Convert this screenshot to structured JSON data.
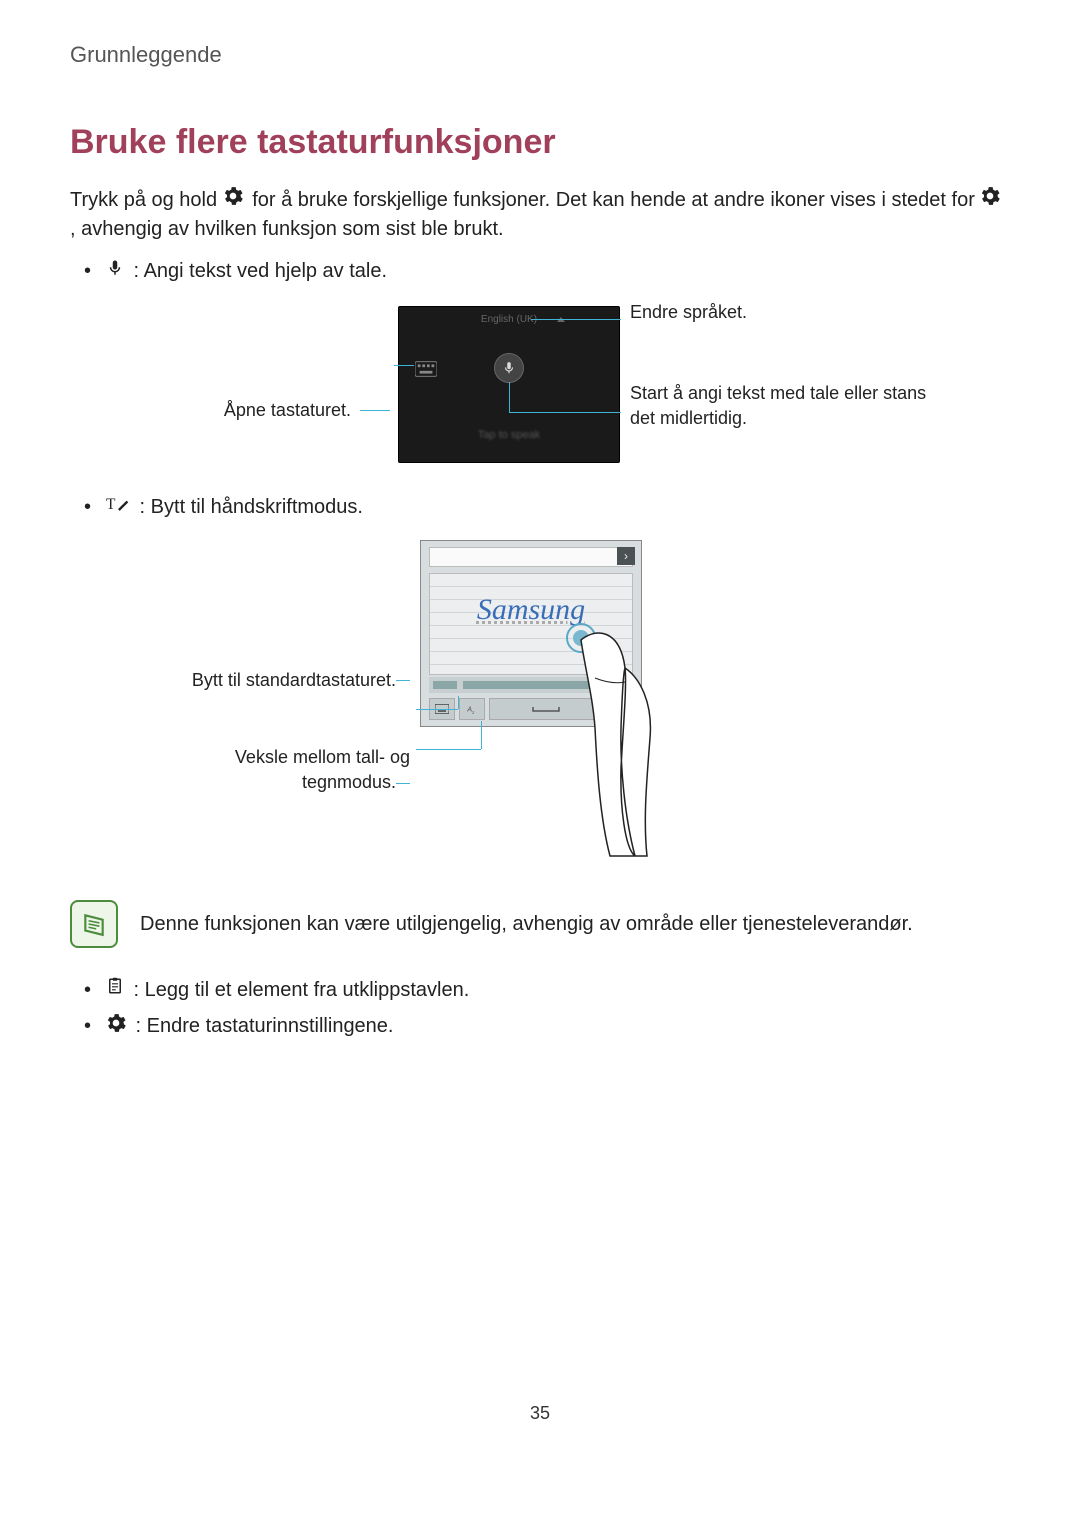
{
  "breadcrumb": "Grunnleggende",
  "title": "Bruke flere tastaturfunksjoner",
  "intro_part1": "Trykk på og hold ",
  "intro_part2": " for å bruke forskjellige funksjoner. Det kan hende at andre ikoner vises i stedet for ",
  "intro_part3": ", avhengig av hvilken funksjon som sist ble brukt.",
  "bullet_voice": " : Angi tekst ved hjelp av tale.",
  "voice_fig": {
    "left_label": "Åpne tastaturet.",
    "right_top": "Endre språket.",
    "right_bottom": "Start å angi tekst med tale eller stans det midlertidig.",
    "lang_text": "English (UK)",
    "tap_text": "Tap to speak"
  },
  "bullet_handwriting": " : Bytt til håndskriftmodus.",
  "hand_fig": {
    "left_top": "Bytt til standardtastaturet.",
    "left_bottom": "Veksle mellom tall- og tegnmodus.",
    "written_text": "Samsung",
    "chevron": "›"
  },
  "note_text": "Denne funksjonen kan være utilgjengelig, avhengig av område eller tjenesteleverandør.",
  "bullet_clipboard": " : Legg til et element fra utklippstavlen.",
  "bullet_settings": " : Endre tastaturinnstillingene.",
  "page_number": "35"
}
